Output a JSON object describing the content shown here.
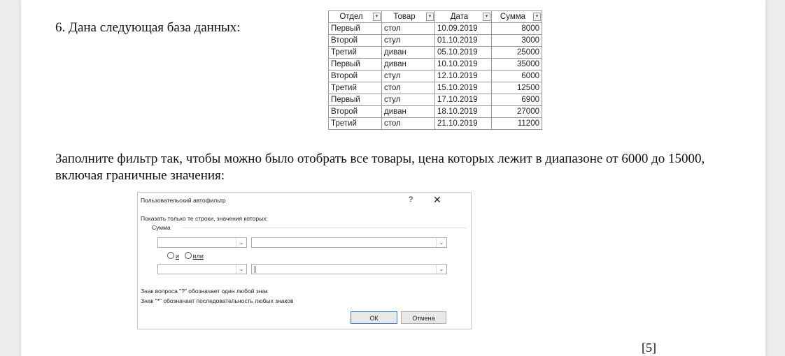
{
  "question": {
    "title": "6. Дана следующая база данных:",
    "instruction": "Заполните фильтр так, чтобы можно было отобрать все товары, цена которых лежит в диапазоне от 6000 до 15000, включая граничные значения:",
    "score": "[5]"
  },
  "table": {
    "headers": [
      "Отдел",
      "Товар",
      "Дата",
      "Сумма"
    ],
    "rows": [
      [
        "Первый",
        "стол",
        "10.09.2019",
        "8000"
      ],
      [
        "Второй",
        "стул",
        "01.10.2019",
        "3000"
      ],
      [
        "Третий",
        "диван",
        "05.10.2019",
        "25000"
      ],
      [
        "Первый",
        "диван",
        "10.10.2019",
        "35000"
      ],
      [
        "Второй",
        "стул",
        "12.10.2019",
        "6000"
      ],
      [
        "Третий",
        "стол",
        "15.10.2019",
        "12500"
      ],
      [
        "Первый",
        "стул",
        "17.10.2019",
        "6900"
      ],
      [
        "Второй",
        "диван",
        "18.10.2019",
        "27000"
      ],
      [
        "Третий",
        "стол",
        "21.10.2019",
        "11200"
      ]
    ]
  },
  "dialog": {
    "title": "Пользовательский автофильтр",
    "help": "?",
    "close": "✕",
    "show_label": "Показать только те строки, значения которых:",
    "field": "Сумма",
    "radio_and": "и",
    "radio_or": "или",
    "hint_question": "Знак вопроса \"?\" обозначает один любой знак",
    "hint_star": "Знак \"*\" обозначает последовательность любых знаков",
    "ok": "ОК",
    "cancel": "Отмена"
  }
}
